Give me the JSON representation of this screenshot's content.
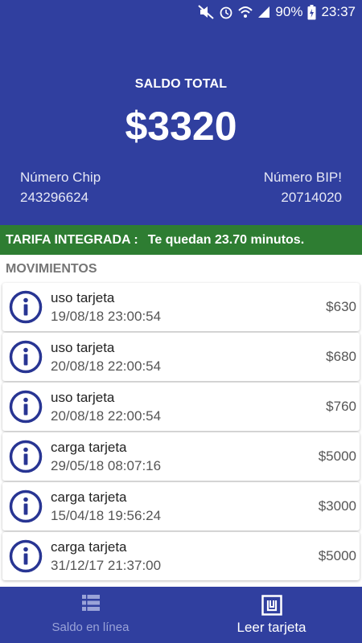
{
  "status_bar": {
    "battery": "90%",
    "time": "23:37",
    "icons": [
      "mute-icon",
      "alarm-icon",
      "wifi-icon",
      "signal-icon",
      "battery-icon"
    ]
  },
  "header": {
    "balance_label": "SALDO TOTAL",
    "balance_amount": "$3320",
    "chip_label": "Número Chip",
    "chip_value": "243296624",
    "bip_label": "Número BIP!",
    "bip_value": "20714020"
  },
  "tarifa": {
    "label": "TARIFA INTEGRADA :",
    "message": "Te quedan 23.70 minutos."
  },
  "movements": {
    "title": "MOVIMIENTOS",
    "items": [
      {
        "type": "uso tarjeta",
        "date": "19/08/18 23:00:54",
        "amount": "$630"
      },
      {
        "type": "uso tarjeta",
        "date": "20/08/18 22:00:54",
        "amount": "$680"
      },
      {
        "type": "uso tarjeta",
        "date": "20/08/18 22:00:54",
        "amount": "$760"
      },
      {
        "type": "carga tarjeta",
        "date": "29/05/18 08:07:16",
        "amount": "$5000"
      },
      {
        "type": "carga tarjeta",
        "date": "15/04/18 19:56:24",
        "amount": "$3000"
      },
      {
        "type": "carga tarjeta",
        "date": "31/12/17 21:37:00",
        "amount": "$5000"
      }
    ]
  },
  "bottom_nav": {
    "items": [
      {
        "label": "Saldo en línea",
        "icon": "list-icon",
        "active": false
      },
      {
        "label": "Leer tarjeta",
        "icon": "card-reader-icon",
        "active": true
      }
    ]
  },
  "colors": {
    "primary": "#303f9f",
    "tarifa_bar": "#2e7d32",
    "info_icon": "#283593"
  }
}
